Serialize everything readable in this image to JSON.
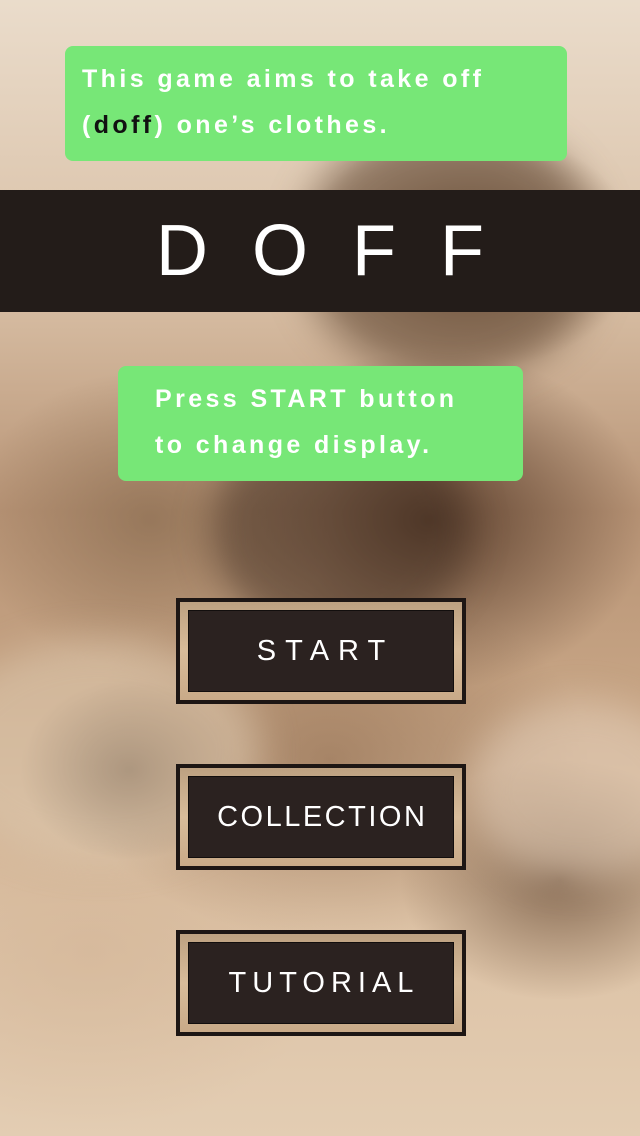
{
  "intro_tip": {
    "line1": "This game aims to take off",
    "line2_open": "(",
    "line2_keyword": "doff",
    "line2_rest": ") one’s clothes."
  },
  "title": "DOFF",
  "hint_tip": {
    "line1": "Press START button",
    "line2": "to change display."
  },
  "menu": {
    "start_label": "START",
    "collection_label": "COLLECTION",
    "tutorial_label": "TUTORIAL"
  },
  "colors": {
    "tip_green": "#77e777",
    "title_bar": "#231c19",
    "button_fill": "#2b2220",
    "button_frame": "#c9aa88"
  },
  "icons": {
    "background": "blurred-photo-background"
  }
}
